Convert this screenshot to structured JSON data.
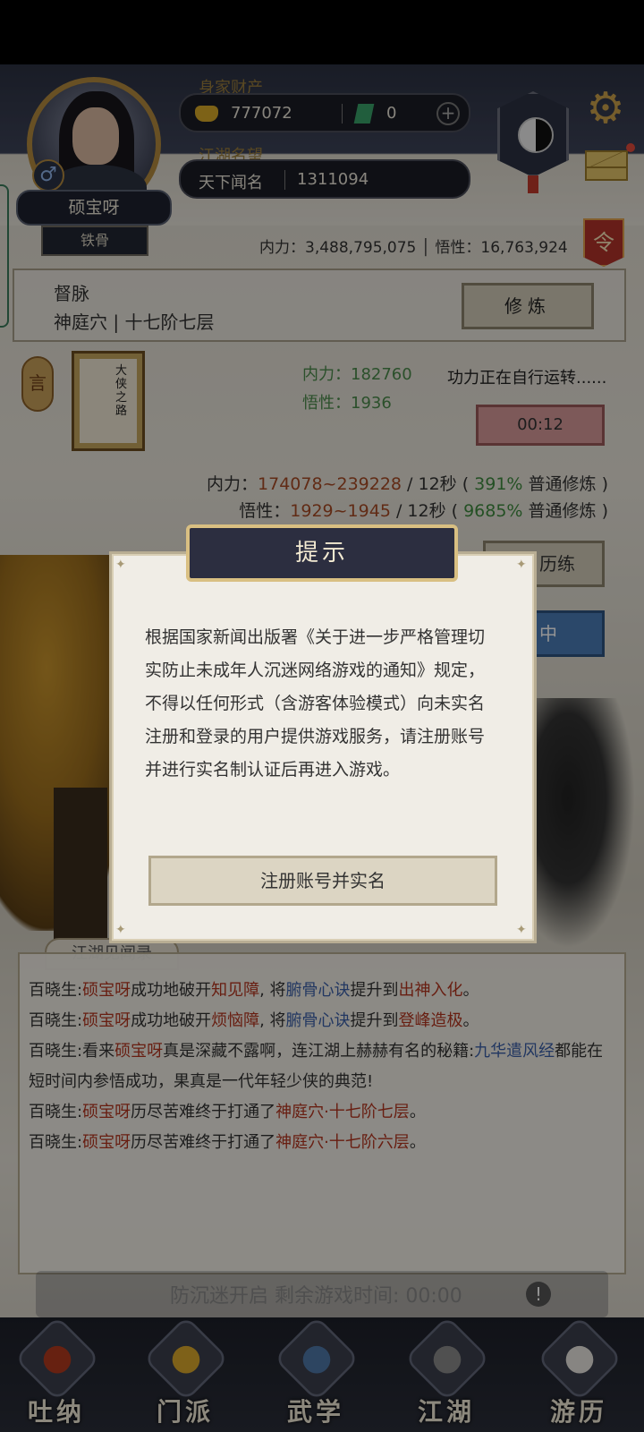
{
  "header": {
    "wealth_label": "身家财产",
    "gold_value": "777072",
    "jade_value": "0",
    "fame_label": "江湖名望",
    "fame_title": "天下闻名",
    "fame_value": "1311094",
    "player_name": "硕宝呀",
    "player_title": "铁骨",
    "gender_symbol": "♂",
    "stats_line": "内力：3,488,795,075 │ 悟性：16,763,924",
    "order_badge": "令"
  },
  "meridian": {
    "title": "督脉",
    "subtitle": "神庭穴 | 十七阶七层",
    "train_button": "修炼"
  },
  "cultivation": {
    "tag": "言",
    "book_title": "大侠之路",
    "neili_gain": "内力：182760",
    "wuxing_gain": "悟性：1936",
    "running_text": "功力正在自行运转......",
    "timer": "00:12",
    "rate_neili_prefix": "内力：",
    "rate_neili_range": "174078~239228",
    "rate_neili_mid": " / 12秒 ( ",
    "rate_neili_pct": "391%",
    "rate_neili_suffix": " 普通修炼 )",
    "rate_wuxing_prefix": "悟性：",
    "rate_wuxing_range": "1929~1945",
    "rate_wuxing_mid": " / 12秒 ( ",
    "rate_wuxing_pct": "9685%",
    "rate_wuxing_suffix": " 普通修炼 )",
    "behind_button_1": "历练",
    "behind_button_2": "中"
  },
  "modal": {
    "title": "提示",
    "body": "根据国家新闻出版署《关于进一步严格管理切实防止未成年人沉迷网络游戏的通知》规定，不得以任何形式（含游客体验模式）向未实名注册和登录的用户提供游戏服务，请注册账号并进行实名制认证后再进入游戏。",
    "button": "注册账号并实名"
  },
  "log": {
    "tab": "江湖见闻录",
    "entries": [
      {
        "a": "百晓生:",
        "b": "硕宝呀",
        "c": "成功地破开",
        "d": "知见障",
        "e": ", 将",
        "f": "腑骨心诀",
        "g": "提升到",
        "h": "出神入化",
        "i": "。"
      },
      {
        "a": "百晓生:",
        "b": "硕宝呀",
        "c": "成功地破开",
        "d": "烦恼障",
        "e": ", 将",
        "f": "腑骨心诀",
        "g": "提升到",
        "h": "登峰造极",
        "i": "。"
      },
      {
        "a": "百晓生:看来",
        "b": "硕宝呀",
        "c": "真是深藏不露啊，连江湖上赫赫有名的秘籍:",
        "d": "九华遣风经",
        "e": "都能在短时间内参悟成功，果真是一代年轻少侠的典范!"
      },
      {
        "a": "百晓生:",
        "b": "硕宝呀",
        "c": "历尽苦难终于打通了",
        "d": "神庭穴·十七阶七层",
        "e": "。"
      },
      {
        "a": "百晓生:",
        "b": "硕宝呀",
        "c": "历尽苦难终于打通了",
        "d": "神庭穴·十七阶六层",
        "e": "。"
      }
    ]
  },
  "anti_addiction": {
    "text": "防沉迷开启 剩余游戏时间: 00:00",
    "icon": "!"
  },
  "nav": {
    "items": [
      "吐纳",
      "门派",
      "武学",
      "江湖",
      "游历"
    ]
  },
  "colors": {
    "accent_gold": "#b38a3e",
    "header_dark": "#2c3142",
    "highlight_red": "#b3341e",
    "highlight_blue": "#3b5fa8",
    "highlight_green": "#3f8a3f"
  }
}
